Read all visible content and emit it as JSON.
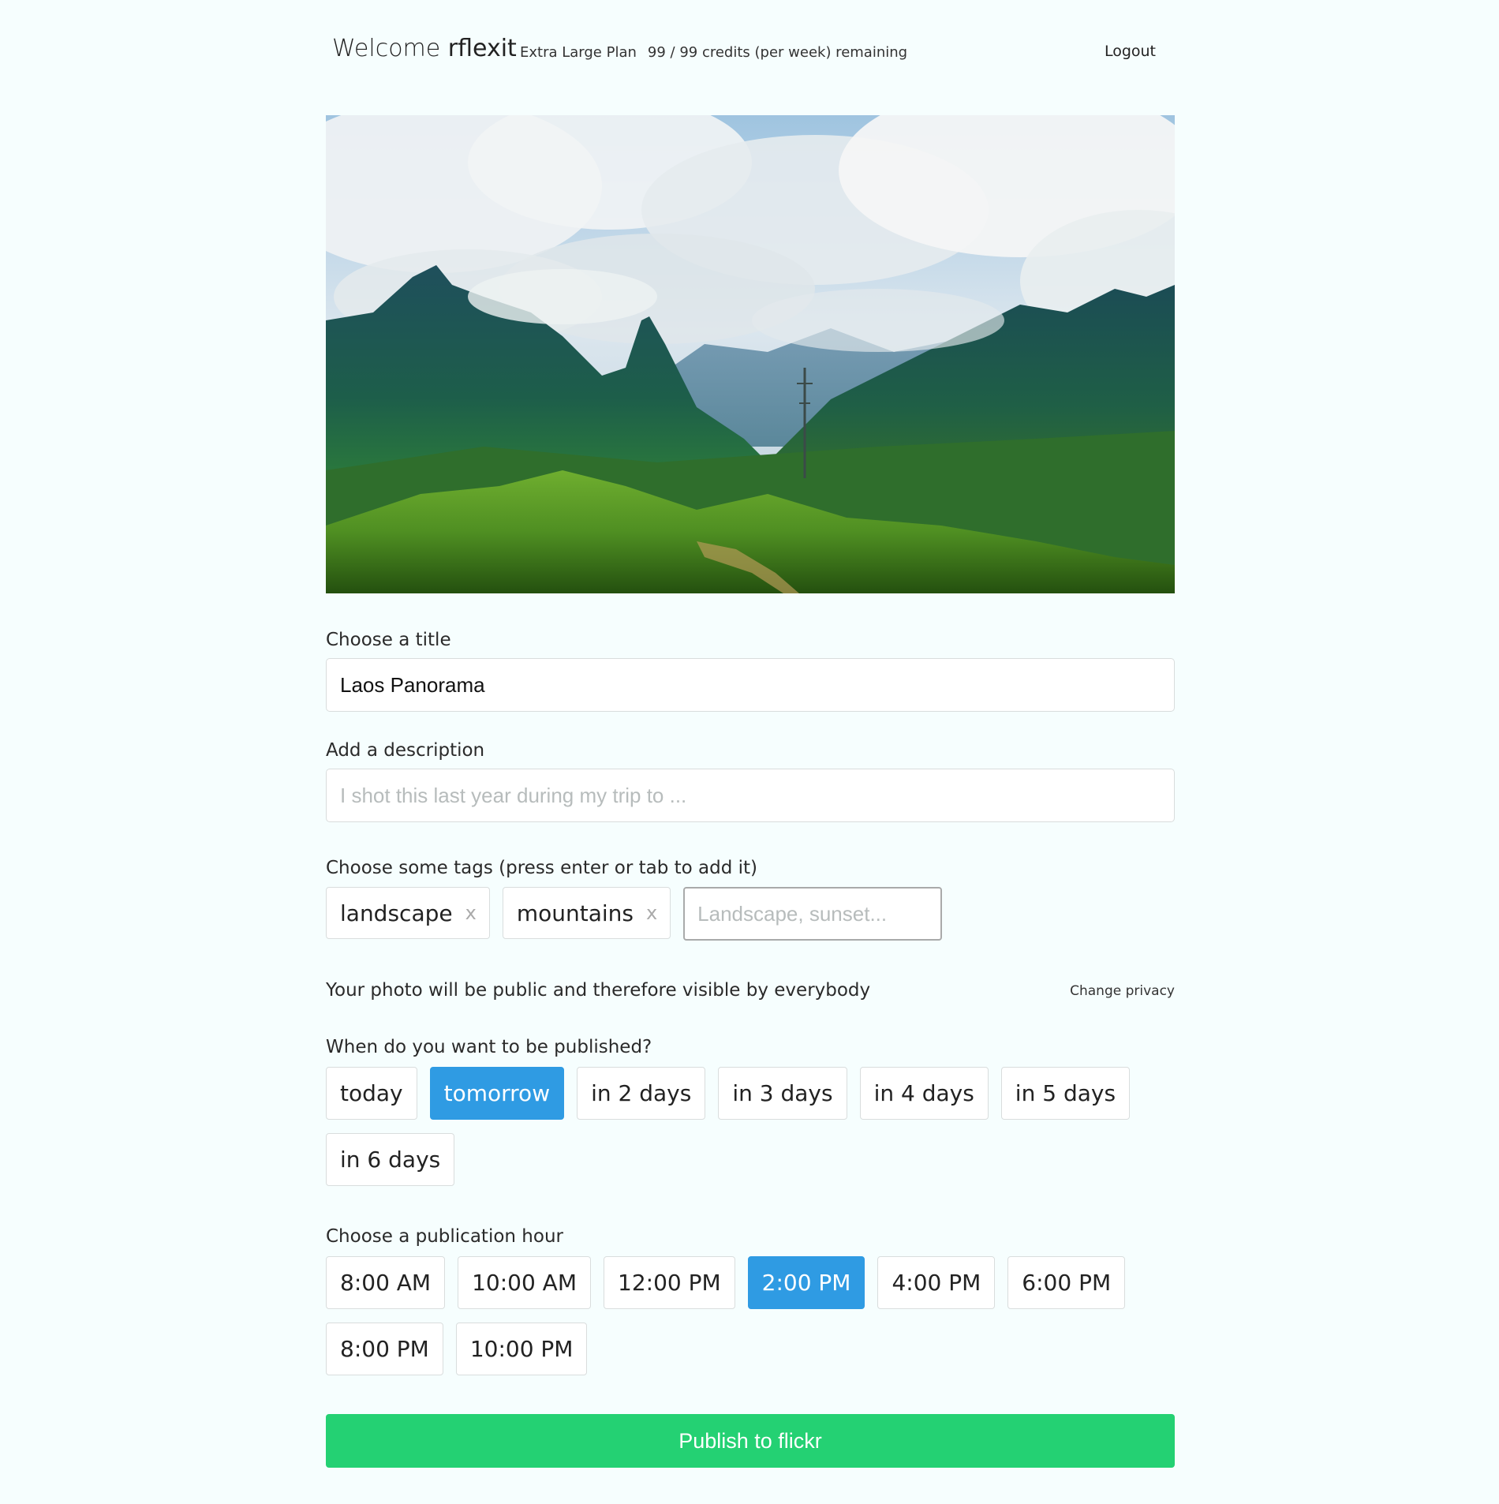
{
  "header": {
    "welcome_prefix": "Welcome",
    "username": "rflexit",
    "plan_name": "Extra Large Plan",
    "credits": "99 / 99 credits (per week) remaining",
    "logout_label": "Logout"
  },
  "form": {
    "title": {
      "label": "Choose a title",
      "value": "Laos Panorama"
    },
    "description": {
      "label": "Add a description",
      "value": "",
      "placeholder": "I shot this last year during my trip to ..."
    },
    "tags": {
      "label": "Choose some tags (press enter or tab to add it)",
      "items": [
        {
          "label": "landscape",
          "remove": "x"
        },
        {
          "label": "mountains",
          "remove": "x"
        }
      ],
      "input_placeholder": "Landscape, sunset..."
    },
    "privacy": {
      "text": "Your photo will be public and therefore visible by everybody",
      "change_label": "Change privacy"
    },
    "publish_day": {
      "label": "When do you want to be published?",
      "options": [
        "today",
        "tomorrow",
        "in 2 days",
        "in 3 days",
        "in 4 days",
        "in 5 days",
        "in 6 days"
      ],
      "selected": "tomorrow"
    },
    "publish_hour": {
      "label": "Choose a publication hour",
      "options": [
        "8:00 AM",
        "10:00 AM",
        "12:00 PM",
        "2:00 PM",
        "4:00 PM",
        "6:00 PM",
        "8:00 PM",
        "10:00 PM"
      ],
      "selected": "2:00 PM"
    },
    "submit_label": "Publish to flickr"
  },
  "colors": {
    "background": "#f6fefe",
    "selected": "#2f9be3",
    "publish": "#24d173"
  }
}
